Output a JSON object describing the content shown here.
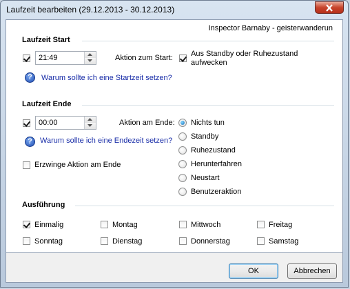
{
  "window": {
    "title": "Laufzeit bearbeiten (29.12.2013 - 30.12.2013)"
  },
  "recording_name": "Inspector Barnaby - geisterwanderun",
  "start": {
    "section_title": "Laufzeit Start",
    "enabled": true,
    "time": "21:49",
    "action_label": "Aktion zum Start:",
    "wake_checked": true,
    "wake_label_line1": "Aus Standby oder Ruhezustand",
    "wake_label_line2": "aufwecken",
    "help_link": "Warum sollte ich eine Startzeit setzen?"
  },
  "end": {
    "section_title": "Laufzeit Ende",
    "enabled": true,
    "time": "00:00",
    "action_label": "Aktion am Ende:",
    "help_link": "Warum sollte ich eine Endezeit setzen?",
    "force_label": "Erzwinge Aktion am Ende",
    "force_checked": false,
    "actions": [
      {
        "label": "Nichts tun",
        "selected": true
      },
      {
        "label": "Standby",
        "selected": false
      },
      {
        "label": "Ruhezustand",
        "selected": false
      },
      {
        "label": "Herunterfahren",
        "selected": false
      },
      {
        "label": "Neustart",
        "selected": false
      },
      {
        "label": "Benutzeraktion",
        "selected": false
      }
    ]
  },
  "execution": {
    "section_title": "Ausführung",
    "days": [
      {
        "label": "Einmalig",
        "checked": true
      },
      {
        "label": "Montag",
        "checked": false
      },
      {
        "label": "Mittwoch",
        "checked": false
      },
      {
        "label": "Freitag",
        "checked": false
      },
      {
        "label": "Sonntag",
        "checked": false
      },
      {
        "label": "Dienstag",
        "checked": false
      },
      {
        "label": "Donnerstag",
        "checked": false
      },
      {
        "label": "Samstag",
        "checked": false
      }
    ]
  },
  "buttons": {
    "ok": "OK",
    "cancel": "Abbrechen"
  }
}
